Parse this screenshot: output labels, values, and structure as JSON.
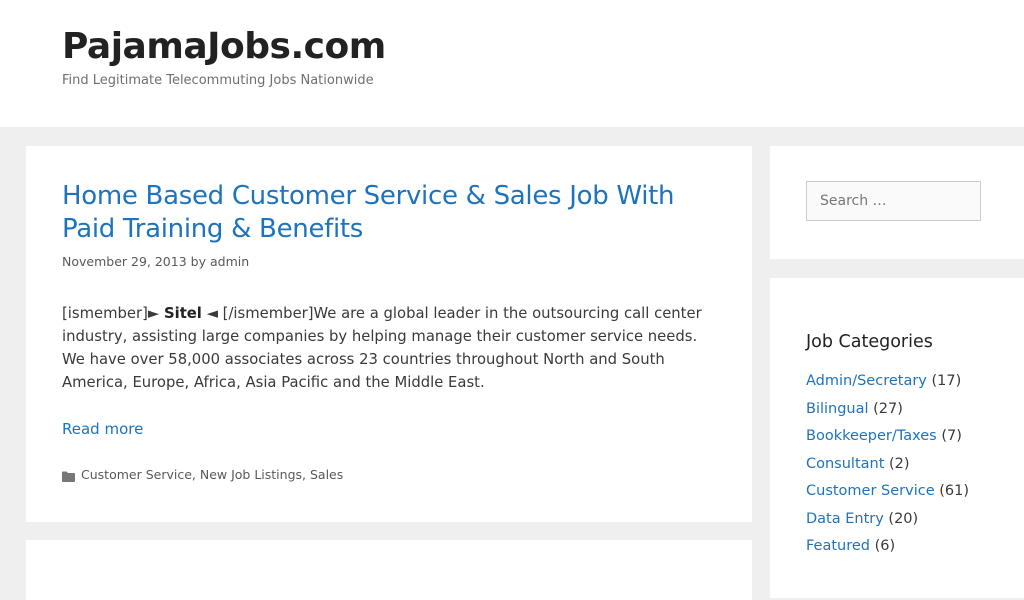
{
  "header": {
    "site_title": "PajamaJobs.com",
    "tagline": "Find Legitimate Telecommuting Jobs Nationwide"
  },
  "post": {
    "title": "Home Based Customer Service & Sales Job With Paid Training & Benefits",
    "date": "November 29, 2013",
    "by_text": "by",
    "author": "admin",
    "summary_prefix": "[ismember]► ",
    "summary_bold": "Sitel",
    "summary_rest": " ◄ [/ismember]We are a global leader in the outsourcing call center industry, assisting large companies by helping manage their customer service needs. We have over 58,000 associates across 23 countries throughout North and South America, Europe, Africa, Asia Pacific and the Middle East.",
    "read_more": "Read more",
    "categories": [
      {
        "label": "Customer Service",
        "sep": ", "
      },
      {
        "label": "New Job Listings",
        "sep": ", "
      },
      {
        "label": "Sales",
        "sep": ""
      }
    ],
    "category_icon": "folder-icon"
  },
  "sidebar": {
    "search_placeholder": "Search …",
    "categories_title": "Job Categories",
    "categories": [
      {
        "label": "Admin/Secretary",
        "count": " (17)"
      },
      {
        "label": "Bilingual",
        "count": " (27)"
      },
      {
        "label": "Bookkeeper/Taxes",
        "count": " (7)"
      },
      {
        "label": "Consultant",
        "count": " (2)"
      },
      {
        "label": "Customer Service",
        "count": " (61)"
      },
      {
        "label": "Data Entry",
        "count": " (20)"
      },
      {
        "label": "Featured",
        "count": " (6)"
      }
    ]
  },
  "colors": {
    "link": "#1e73be",
    "background": "#efefef",
    "panel": "#ffffff"
  }
}
